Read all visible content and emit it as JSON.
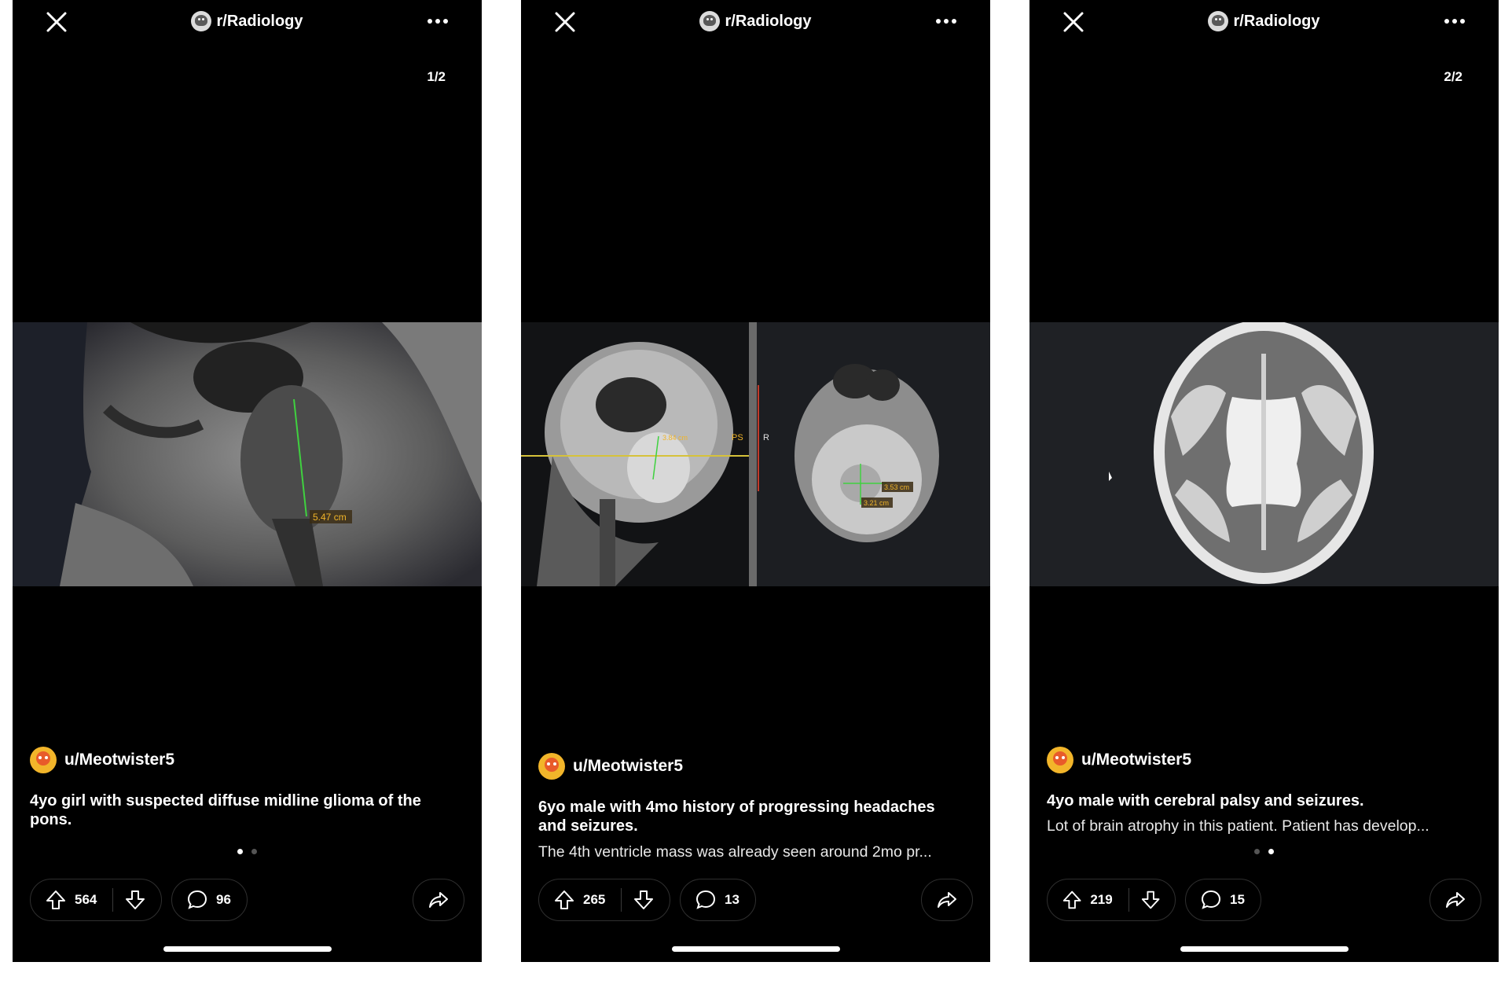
{
  "screens": [
    {
      "subreddit": "r/Radiology",
      "counter": "1/2",
      "author": "u/Meotwister5",
      "title": "4yo girl with suspected diffuse midline glioma of the pons.",
      "description": "",
      "measure_labels": [
        "5.47 cm"
      ],
      "upvotes": "564",
      "comments": "96",
      "carousel_page": 1,
      "carousel_total": 2
    },
    {
      "subreddit": "r/Radiology",
      "counter": "",
      "author": "u/Meotwister5",
      "title": "6yo male with 4mo history of progressing headaches and seizures.",
      "description": "The 4th ventricle mass was already seen around 2mo pr...",
      "measure_labels": [
        "3.84 cm",
        "3.53 cm",
        "3.21 cm",
        "PS",
        "R"
      ],
      "upvotes": "265",
      "comments": "13"
    },
    {
      "subreddit": "r/Radiology",
      "counter": "2/2",
      "author": "u/Meotwister5",
      "title": "4yo male with cerebral palsy and seizures.",
      "description": "Lot of brain atrophy in this patient. Patient has develop...",
      "upvotes": "219",
      "comments": "15",
      "carousel_page": 2,
      "carousel_total": 2
    }
  ],
  "colors": {
    "background": "#000000",
    "text": "#ffffff",
    "measure": "#f0b429",
    "pill_border": "#2f2f2f"
  },
  "icons": [
    "close-icon",
    "subreddit-icon",
    "more-icon",
    "upvote-icon",
    "downvote-icon",
    "comment-icon",
    "share-icon"
  ]
}
